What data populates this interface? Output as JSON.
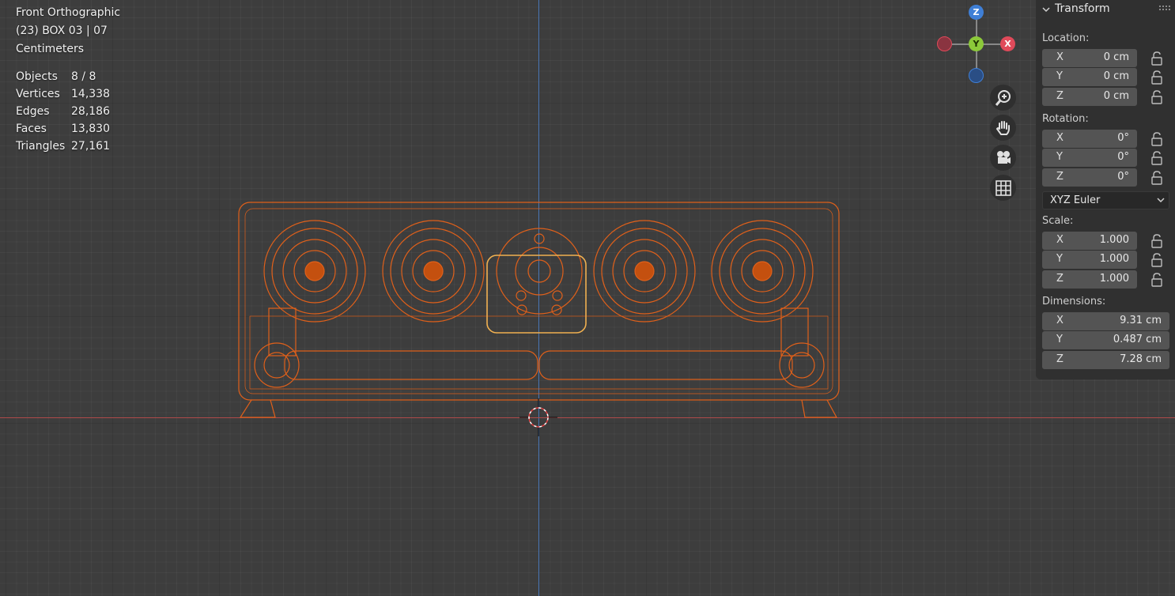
{
  "viewport": {
    "view_name": "Front Orthographic",
    "collection_info": "(23) BOX 03 | 07",
    "units": "Centimeters",
    "stats": [
      {
        "label": "Objects",
        "value": "8 / 8"
      },
      {
        "label": "Vertices",
        "value": "14,338"
      },
      {
        "label": "Edges",
        "value": "28,186"
      },
      {
        "label": "Faces",
        "value": "13,830"
      },
      {
        "label": "Triangles",
        "value": "27,161"
      }
    ]
  },
  "gizmo": {
    "z_label": "Z",
    "y_label": "Y",
    "x_label": "X",
    "colors": {
      "x": "#e04a5a",
      "y": "#8cc93a",
      "z": "#3f7fd6"
    }
  },
  "nav_buttons": [
    {
      "icon": "zoom-icon"
    },
    {
      "icon": "pan-hand-icon"
    },
    {
      "icon": "camera-icon"
    },
    {
      "icon": "grid-icon"
    }
  ],
  "sidebar": {
    "panel_title": "Transform",
    "location_label": "Location:",
    "location": [
      {
        "axis": "X",
        "value": "0 cm"
      },
      {
        "axis": "Y",
        "value": "0 cm"
      },
      {
        "axis": "Z",
        "value": "0 cm"
      }
    ],
    "rotation_label": "Rotation:",
    "rotation": [
      {
        "axis": "X",
        "value": "0°"
      },
      {
        "axis": "Y",
        "value": "0°"
      },
      {
        "axis": "Z",
        "value": "0°"
      }
    ],
    "rotation_mode": "XYZ Euler",
    "scale_label": "Scale:",
    "scale": [
      {
        "axis": "X",
        "value": "1.000"
      },
      {
        "axis": "Y",
        "value": "1.000"
      },
      {
        "axis": "Z",
        "value": "1.000"
      }
    ],
    "dimensions_label": "Dimensions:",
    "dimensions": [
      {
        "axis": "X",
        "value": "9.31 cm"
      },
      {
        "axis": "Y",
        "value": "0.487 cm"
      },
      {
        "axis": "Z",
        "value": "7.28 cm"
      }
    ]
  },
  "model": {
    "wire_color": "#e0601a",
    "highlight_color": "#f0b050"
  }
}
